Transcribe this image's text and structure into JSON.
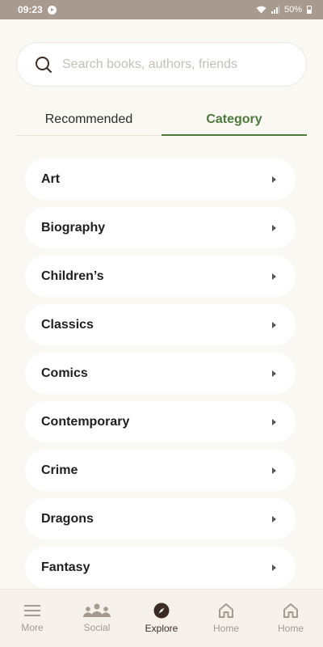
{
  "status_bar": {
    "time": "09:23",
    "battery": "50%"
  },
  "search": {
    "placeholder": "Search books, authors, friends"
  },
  "tabs": [
    {
      "label": "Recommended",
      "active": false
    },
    {
      "label": "Category",
      "active": true
    }
  ],
  "categories": [
    {
      "label": "Art"
    },
    {
      "label": "Biography"
    },
    {
      "label": "Children’s"
    },
    {
      "label": "Classics"
    },
    {
      "label": "Comics"
    },
    {
      "label": "Contemporary"
    },
    {
      "label": "Crime"
    },
    {
      "label": "Dragons"
    },
    {
      "label": "Fantasy"
    }
  ],
  "bottom_nav": [
    {
      "label": "More",
      "icon": "menu-icon",
      "active": false
    },
    {
      "label": "Social",
      "icon": "people-icon",
      "active": false
    },
    {
      "label": "Explore",
      "icon": "compass-icon",
      "active": true
    },
    {
      "label": "Home",
      "icon": "home-icon",
      "active": false
    },
    {
      "label": "Home",
      "icon": "home-icon",
      "active": false
    }
  ],
  "colors": {
    "accent": "#4d7a3a",
    "background": "#faf8f3",
    "status_bar": "#a89a8e",
    "nav_active": "#3a2c24",
    "nav_inactive": "#a39a90"
  }
}
